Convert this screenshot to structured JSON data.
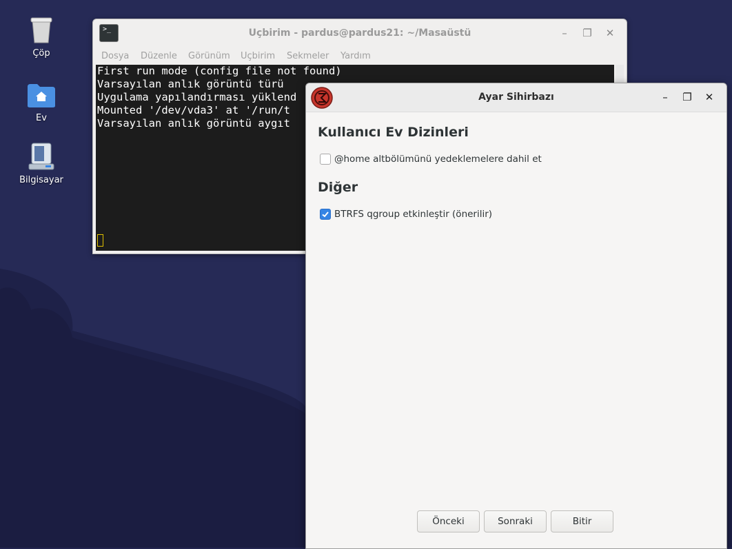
{
  "desktop": {
    "icons": [
      {
        "label": "Çöp",
        "icon": "trash-icon"
      },
      {
        "label": "Ev",
        "icon": "home-folder-icon"
      },
      {
        "label": "Bilgisayar",
        "icon": "computer-icon"
      }
    ]
  },
  "terminal": {
    "title": "Uçbirim - pardus@pardus21: ~/Masaüstü",
    "menu": [
      "Dosya",
      "Düzenle",
      "Görünüm",
      "Uçbirim",
      "Sekmeler",
      "Yardım"
    ],
    "lines": [
      "First run mode (config file not found)",
      "Varsayılan anlık görüntü türü",
      "Uygulama yapılandırması yüklend",
      "Mounted '/dev/vda3' at '/run/t",
      "Varsayılan anlık görüntü aygıt"
    ]
  },
  "dialog": {
    "title": "Ayar Sihirbazı",
    "sections": [
      {
        "heading": "Kullanıcı Ev Dizinleri"
      },
      {
        "heading": "Diğer"
      }
    ],
    "checkboxes": [
      {
        "label": "@home altbölümünü yedeklemelere dahil et",
        "checked": false
      },
      {
        "label": "BTRFS qgroup etkinleştir (önerilir)",
        "checked": true
      }
    ],
    "buttons": {
      "back": "Önceki",
      "next": "Sonraki",
      "finish": "Bitir"
    }
  },
  "colors": {
    "desktop_bg": "#24264f",
    "accent": "#3584e4",
    "terminal_bg": "#1c1c1c"
  }
}
